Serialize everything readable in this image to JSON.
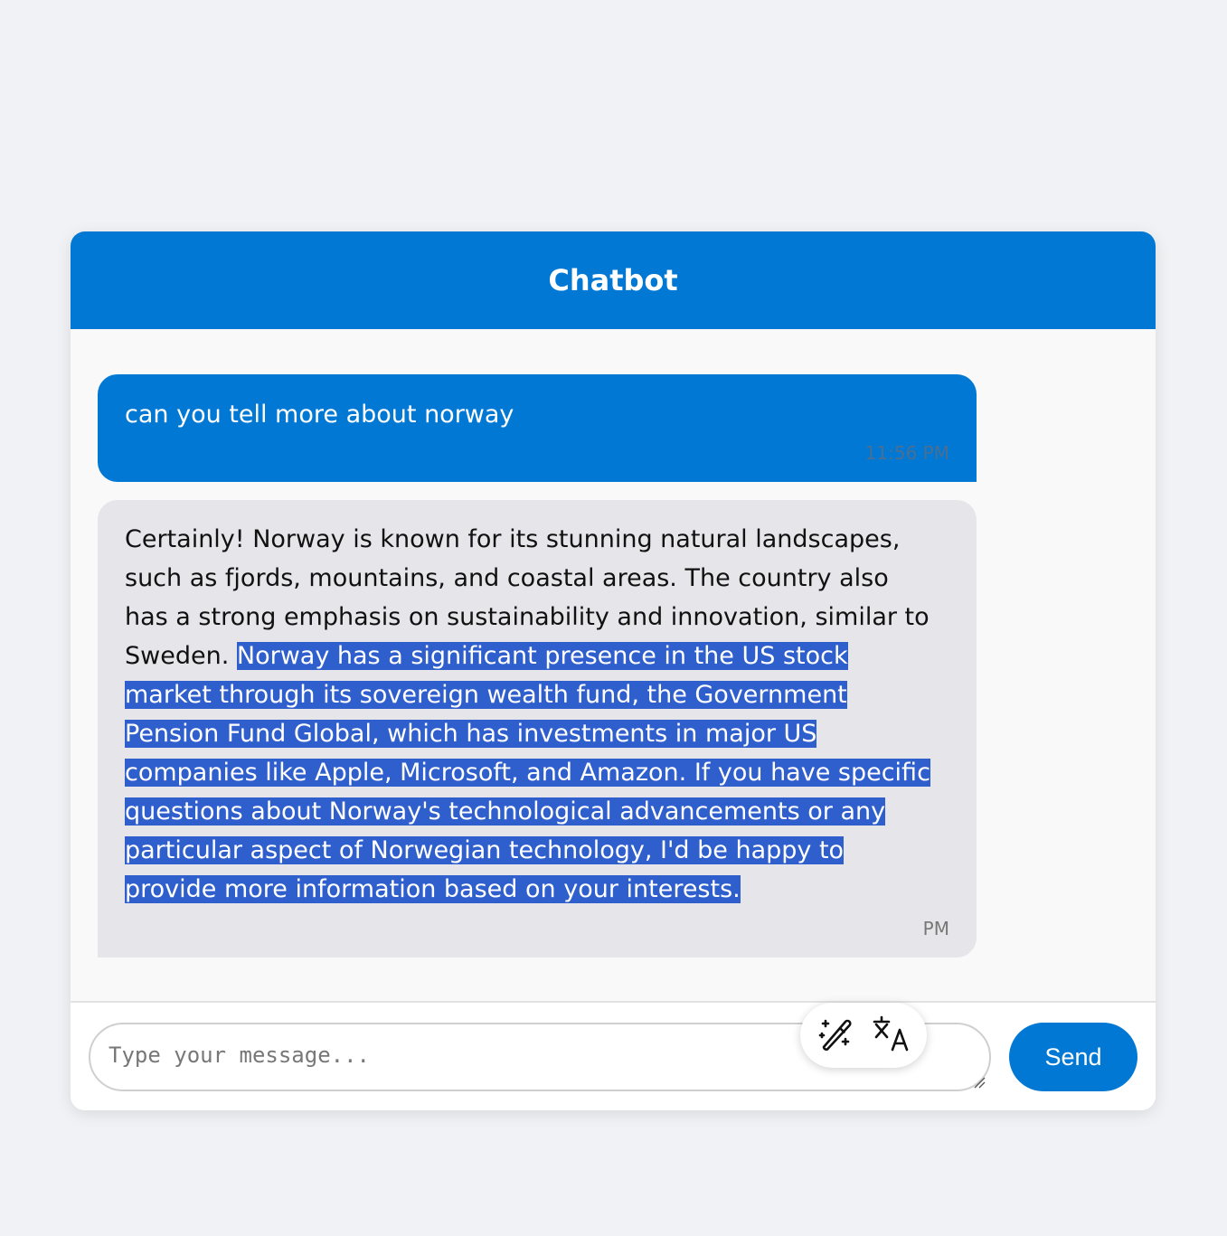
{
  "header": {
    "title": "Chatbot"
  },
  "messages": {
    "user": {
      "text": "can you tell more about norway",
      "time": "11:56 PM"
    },
    "bot": {
      "text_plain": "Certainly! Norway is known for its stunning natural landscapes, such as fjords, mountains, and coastal areas. The country also has a strong emphasis on sustainability and innovation, similar to Sweden. ",
      "text_selected": "Norway has a significant presence in the US stock market through its sovereign wealth fund, the Government Pension Fund Global, which has investments in major US companies like Apple, Microsoft, and Amazon. If you have specific questions about Norway's technological advancements or any particular aspect of Norwegian technology, I'd be happy to provide more information based on your interests.",
      "time_visible": "PM"
    }
  },
  "selection_toolbar": {
    "icons": [
      "magic-wand-icon",
      "translate-icon"
    ]
  },
  "input": {
    "placeholder": "Type your message...",
    "value": ""
  },
  "send": {
    "label": "Send"
  },
  "colors": {
    "accent": "#0078d4",
    "selection": "#2f5fcc",
    "bot_bubble": "#e6e5ea",
    "page_bg": "#f1f2f5"
  }
}
